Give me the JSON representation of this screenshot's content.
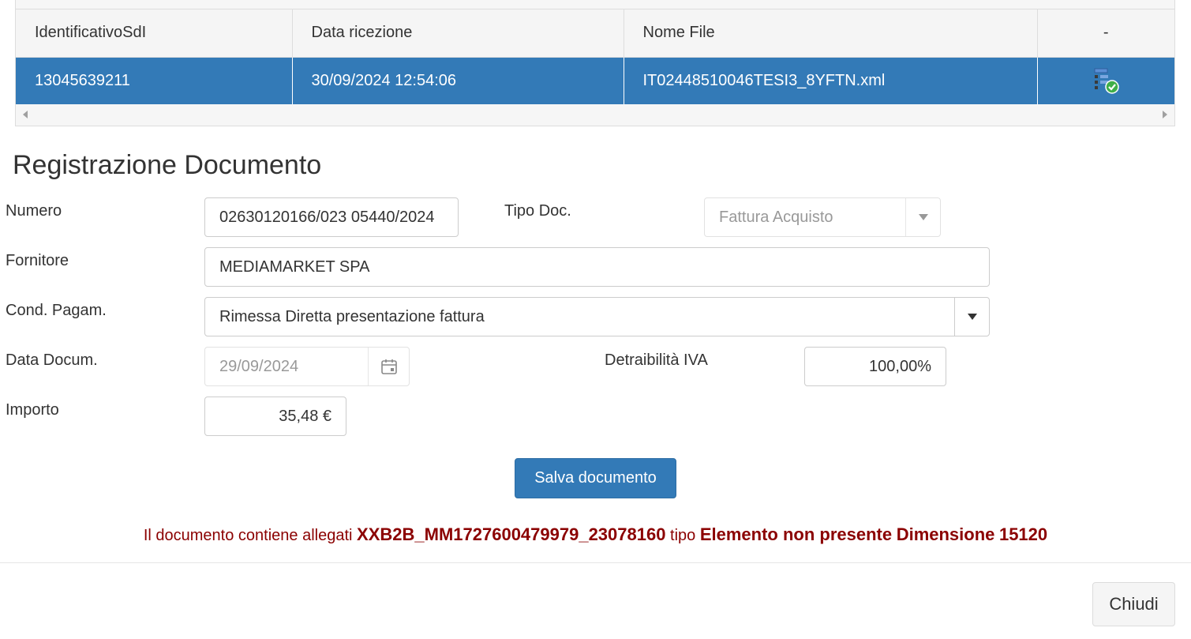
{
  "grid": {
    "columns": [
      "IdentificativoSdI",
      "Data ricezione",
      "Nome File",
      "-"
    ],
    "rows": [
      {
        "id_sdi": "13045639211",
        "data_ricezione": "30/09/2024 12:54:06",
        "nome_file": "IT02448510046TESI3_8YFTN.xml",
        "action_icon": "document-tree-check-icon"
      }
    ]
  },
  "form": {
    "title": "Registrazione Documento",
    "numero": {
      "label": "Numero",
      "value": "02630120166/023 05440/2024"
    },
    "tipo_doc": {
      "label": "Tipo Doc.",
      "value": "Fattura Acquisto"
    },
    "fornitore": {
      "label": "Fornitore",
      "value": "MEDIAMARKET SPA"
    },
    "cond_pagam": {
      "label": "Cond. Pagam.",
      "value": "Rimessa Diretta presentazione fattura"
    },
    "data_docum": {
      "label": "Data Docum.",
      "value": "29/09/2024"
    },
    "detraibilita": {
      "label": "Detraibilità IVA",
      "value": "100,00%"
    },
    "importo": {
      "label": "Importo",
      "value": "35,48 €"
    },
    "save_label": "Salva documento"
  },
  "attachment": {
    "prefix": "Il documento contiene allegati",
    "name": "XXB2B_MM1727600479979_23078160",
    "type_label": "tipo",
    "type_value": "Elemento non presente",
    "size_label": "Dimensione",
    "size_value": "15120"
  },
  "footer": {
    "close_label": "Chiudi"
  },
  "colors": {
    "selected_row": "#337ab7",
    "primary_button": "#337ab7",
    "attachment_text": "#8b0000"
  }
}
